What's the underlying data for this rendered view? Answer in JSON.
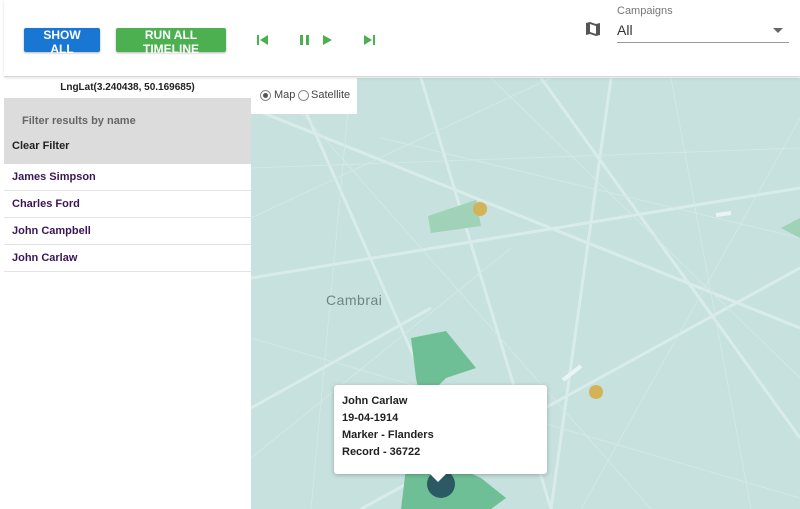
{
  "toolbar": {
    "show_all_label": "SHOW ALL",
    "run_timeline_label": "RUN ALL TIMELINE",
    "campaigns_label": "Campaigns",
    "campaigns_value": "All"
  },
  "sidebar": {
    "lnglat": "LngLat(3.240438, 50.169685)",
    "filter_placeholder": "Filter results by name",
    "clear_filter_label": "Clear Filter",
    "people": [
      "James Simpson",
      "Charles Ford",
      "John Campbell",
      "John Carlaw"
    ]
  },
  "map": {
    "style_options": [
      "Map",
      "Satellite"
    ],
    "selected_style": "Map",
    "city_label": "Cambrai",
    "popup": {
      "name": "John Carlaw",
      "date": "19-04-1914",
      "marker": "Marker - Flanders",
      "record": "Record - 36722"
    }
  },
  "colors": {
    "blue_button": "#1976d2",
    "green_button": "#4caf50",
    "map_water": "#c6e1de",
    "park": "#6fbf96",
    "marker_gold": "#d4b256",
    "marker_dark": "#2c5a64"
  }
}
